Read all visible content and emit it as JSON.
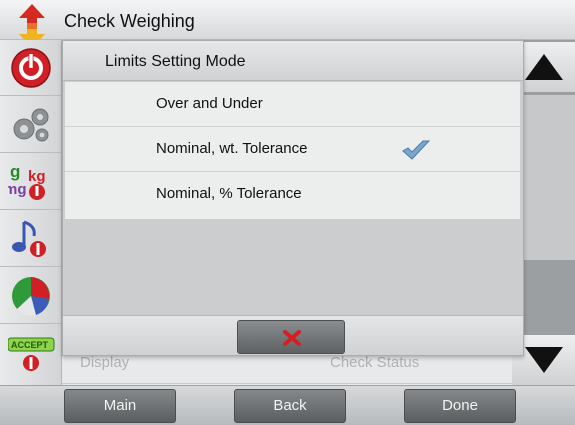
{
  "header": {
    "title": "Check Weighing",
    "logo_icon": "up-down-arrow-icon"
  },
  "left_icons": [
    {
      "name": "power-icon",
      "label": ""
    },
    {
      "name": "gears-icon",
      "label": ""
    },
    {
      "name": "units-icon",
      "label": "g kg mg"
    },
    {
      "name": "music-note-icon",
      "label": ""
    },
    {
      "name": "pie-chart-icon",
      "label": ""
    },
    {
      "name": "accept-icon",
      "label": "ACCEPT"
    }
  ],
  "background_list": {
    "row_left": "Display",
    "row_right": "Check Status"
  },
  "dialog": {
    "title": "Limits Setting Mode",
    "options": [
      {
        "label": "Over and Under",
        "selected": false
      },
      {
        "label": "Nominal, wt. Tolerance",
        "selected": true
      },
      {
        "label": "Nominal, % Tolerance",
        "selected": false
      }
    ],
    "cancel_icon": "close-icon"
  },
  "bottom_nav": {
    "main": "Main",
    "back": "Back",
    "done": "Done"
  },
  "colors": {
    "accent_red": "#d71d24",
    "check_blue": "#6f9fc8",
    "button_gray": "#6c6f71"
  }
}
